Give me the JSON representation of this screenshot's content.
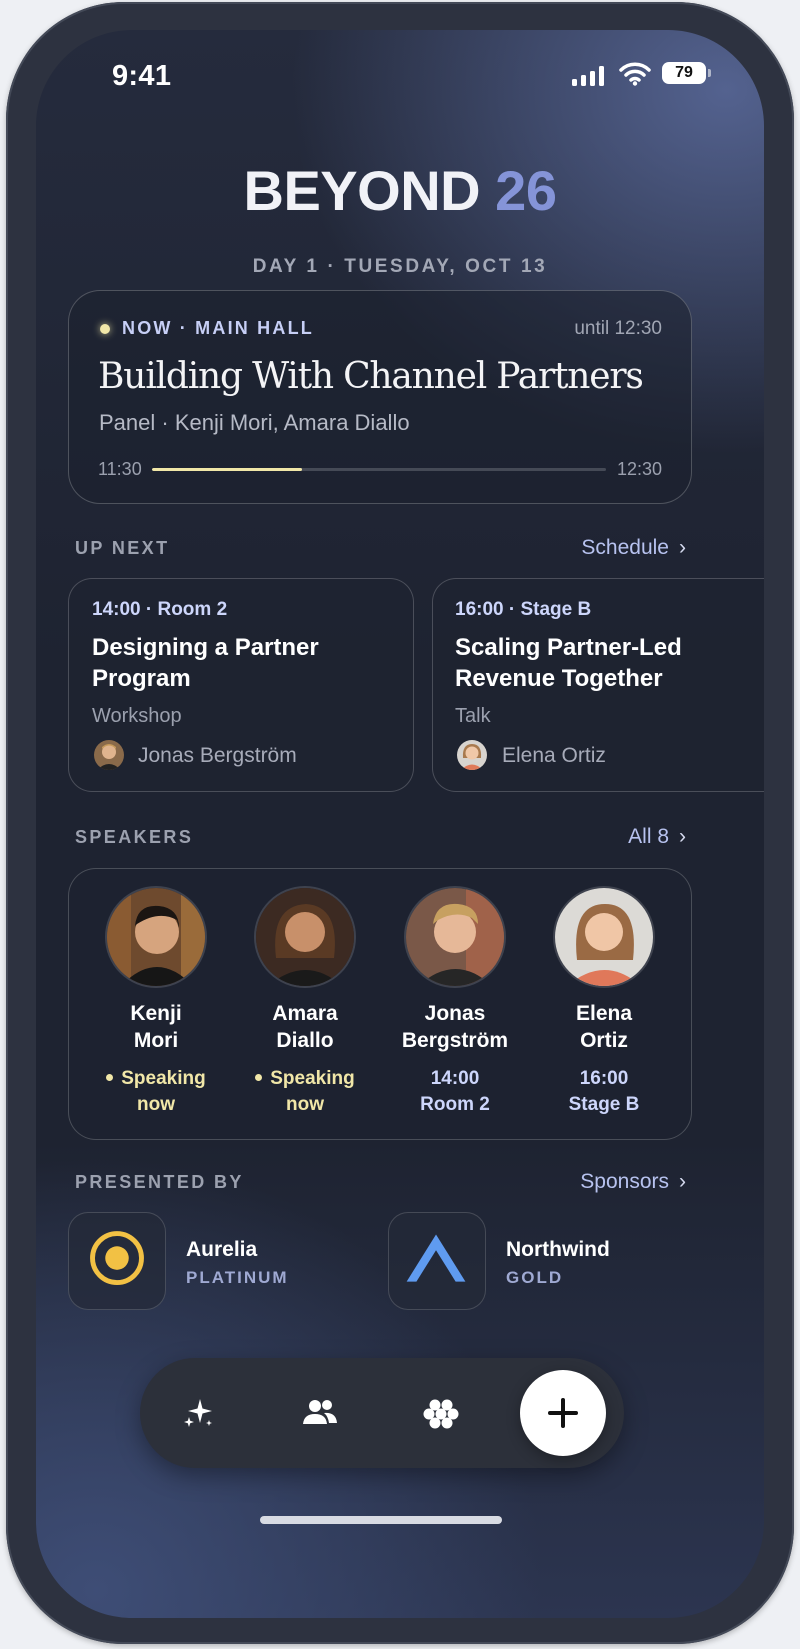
{
  "status_bar": {
    "time": "9:41",
    "battery": "79"
  },
  "header": {
    "brand_name": "BEYOND",
    "brand_year": "26",
    "date_line": "DAY 1 · TUESDAY, OCT 13"
  },
  "now": {
    "label": "NOW · MAIN HALL",
    "until": "until 12:30",
    "title": "Building With Channel Partners",
    "subtitle": "Panel · Kenji Mori, Amara Diallo",
    "start": "11:30",
    "end": "12:30",
    "progress": 0.33
  },
  "up_next": {
    "label": "UP NEXT",
    "link": "Schedule",
    "cards": [
      {
        "meta": "14:00 · Room 2",
        "title": "Designing a Partner Program",
        "type": "Workshop",
        "speaker": "Jonas Bergström"
      },
      {
        "meta": "16:00 · Stage B",
        "title": "Scaling Partner-Led Revenue Together",
        "type": "Talk",
        "speaker": "Elena Ortiz"
      }
    ]
  },
  "speakers": {
    "label": "SPEAKERS",
    "link": "All 8",
    "items": [
      {
        "first": "Kenji",
        "last": "Mori",
        "status1": "Speaking",
        "status2": "now"
      },
      {
        "first": "Amara",
        "last": "Diallo",
        "status1": "Speaking",
        "status2": "now"
      },
      {
        "first": "Jonas",
        "last": "Bergström",
        "status1": "14:00",
        "status2": "Room 2"
      },
      {
        "first": "Elena",
        "last": "Ortiz",
        "status1": "16:00",
        "status2": "Stage B"
      }
    ]
  },
  "sponsors": {
    "label": "PRESENTED BY",
    "link": "Sponsors",
    "items": [
      {
        "name": "Aurelia",
        "tier": "PLATINUM",
        "icon": "target-ring-icon",
        "color": "#f2c144"
      },
      {
        "name": "Northwind",
        "tier": "GOLD",
        "icon": "peak-icon",
        "color": "#5f9bf0"
      }
    ]
  },
  "tabbar": {
    "icons": [
      "sparkles-icon",
      "people-icon",
      "sponsors-flower-icon"
    ],
    "fab_icon": "plus-icon"
  },
  "colors": {
    "accent": "#8594d8",
    "live": "#f1e7a8",
    "link": "#b7c2ef"
  }
}
